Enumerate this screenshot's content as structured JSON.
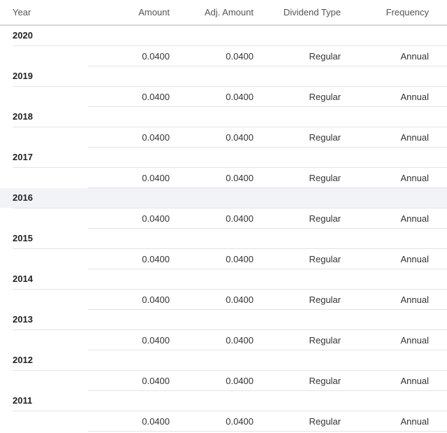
{
  "table": {
    "headers": {
      "year": "Year",
      "amount": "Amount",
      "adj_amount": "Adj. Amount",
      "dividend_type": "Dividend Type",
      "frequency": "Frequency"
    },
    "rows": [
      {
        "year": "2020",
        "amount": "0.0400",
        "adj_amount": "0.0400",
        "dividend_type": "Regular",
        "frequency": "Annual"
      },
      {
        "year": "2019",
        "amount": "0.0400",
        "adj_amount": "0.0400",
        "dividend_type": "Regular",
        "frequency": "Annual"
      },
      {
        "year": "2018",
        "amount": "0.0400",
        "adj_amount": "0.0400",
        "dividend_type": "Regular",
        "frequency": "Annual"
      },
      {
        "year": "2017",
        "amount": "0.0400",
        "adj_amount": "0.0400",
        "dividend_type": "Regular",
        "frequency": "Annual"
      },
      {
        "year": "2016",
        "amount": "0.0400",
        "adj_amount": "0.0400",
        "dividend_type": "Regular",
        "frequency": "Annual",
        "highlighted": true
      },
      {
        "year": "2015",
        "amount": "0.0400",
        "adj_amount": "0.0400",
        "dividend_type": "Regular",
        "frequency": "Annual"
      },
      {
        "year": "2014",
        "amount": "0.0400",
        "adj_amount": "0.0400",
        "dividend_type": "Regular",
        "frequency": "Annual"
      },
      {
        "year": "2013",
        "amount": "0.0400",
        "adj_amount": "0.0400",
        "dividend_type": "Regular",
        "frequency": "Annual"
      },
      {
        "year": "2012",
        "amount": "0.0400",
        "adj_amount": "0.0400",
        "dividend_type": "Regular",
        "frequency": "Annual"
      },
      {
        "year": "2011",
        "amount": "0.0400",
        "adj_amount": "0.0400",
        "dividend_type": "Regular",
        "frequency": "Annual"
      }
    ]
  }
}
